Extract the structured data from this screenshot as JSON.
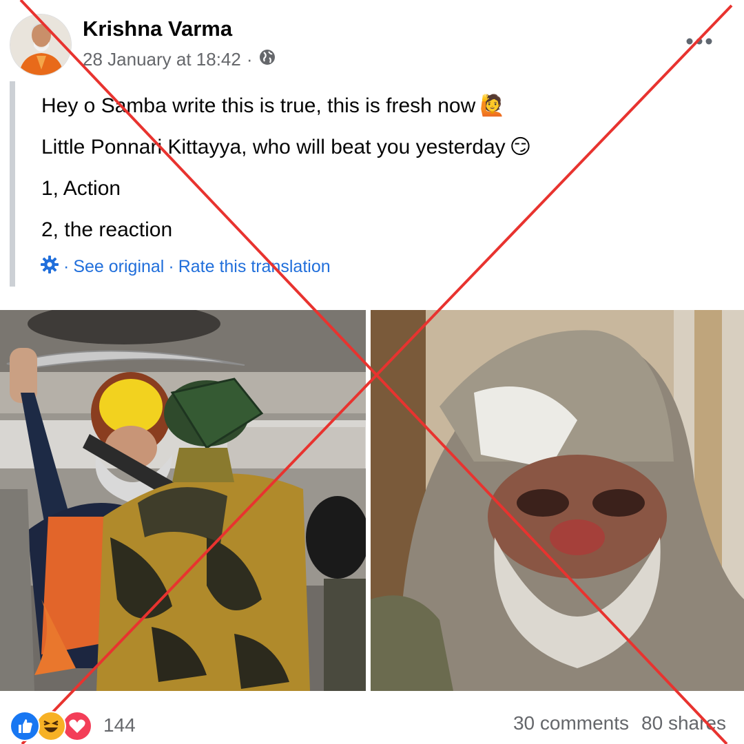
{
  "post": {
    "author": "Krishna Varma",
    "timestamp": "28 January at 18:42",
    "separator": "·",
    "audience_icon": "globe-icon",
    "more_icon": "more-options-icon"
  },
  "body": {
    "lines": [
      "Hey o Samba write this is true, this is fresh now",
      "Little Ponnari Kittayya, who will beat you yesterday",
      "1, Action",
      "2, the reaction"
    ],
    "emoji": [
      "🙋",
      "😏"
    ]
  },
  "translation": {
    "icon": "gear-icon",
    "prefix": "·",
    "see_original": "See original",
    "middle": "·",
    "rate": "Rate this translation"
  },
  "footer": {
    "reaction_icons": [
      "like-icon",
      "haha-icon",
      "love-icon"
    ],
    "reaction_count": "144",
    "comments": "30 comments",
    "shares": "80 shares"
  },
  "colors": {
    "link": "#216fdb",
    "muted": "#65676b",
    "cross": "#e8332f",
    "like": "#1877f2",
    "love": "#f33e58",
    "haha": "#f7b125"
  }
}
